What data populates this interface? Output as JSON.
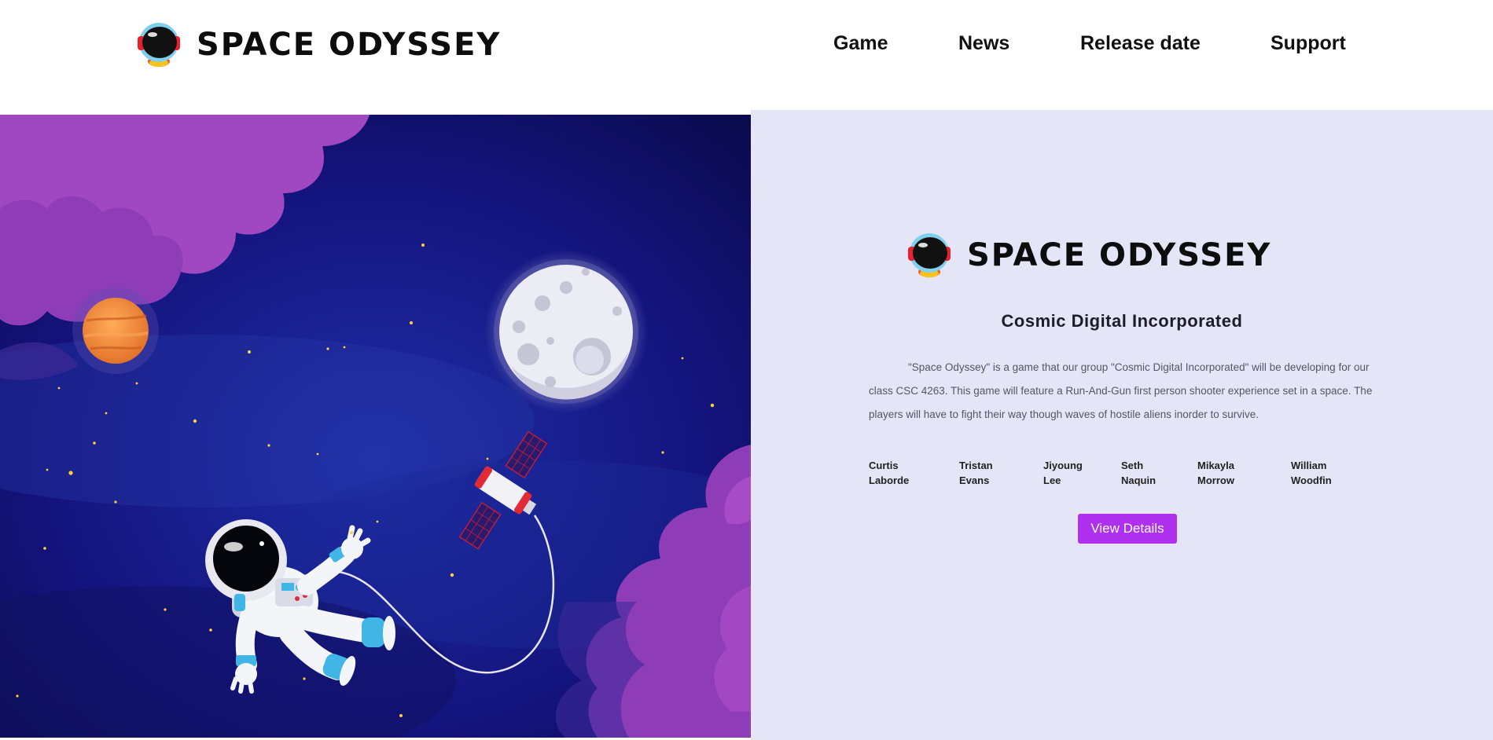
{
  "header": {
    "brand": "SPACE ODYSSEY",
    "nav": [
      "Game",
      "News",
      "Release date",
      "Support"
    ]
  },
  "info": {
    "brand": "SPACE ODYSSEY",
    "company": "Cosmic Digital Incorporated",
    "description": "\"Space Odyssey\" is a game that our group \"Cosmic Digital Incorporated\" will be developing for our class CSC 4263. This game will feature a Run-And-Gun first person shooter experience set in a space. The players will have to fight their way though waves of hostile aliens inorder to survive.",
    "members": [
      {
        "first": "Curtis",
        "last": "Laborde"
      },
      {
        "first": "Tristan",
        "last": "Evans"
      },
      {
        "first": "Jiyoung",
        "last": "Lee"
      },
      {
        "first": "Seth",
        "last": "Naquin"
      },
      {
        "first": "Mikayla",
        "last": "Morrow"
      },
      {
        "first": "William",
        "last": "Woodfin"
      }
    ],
    "button_label": "View Details"
  },
  "hero": {
    "illustration": "astronaut-floating-in-space",
    "elements": [
      "purple-clouds",
      "orange-planet",
      "moon",
      "satellite",
      "astronaut",
      "stars"
    ]
  },
  "colors": {
    "panel_bg": "#e5e5f8",
    "button_bg": "#b030f0",
    "space_bg": "#14147a",
    "cloud": "#8a3cb4"
  }
}
